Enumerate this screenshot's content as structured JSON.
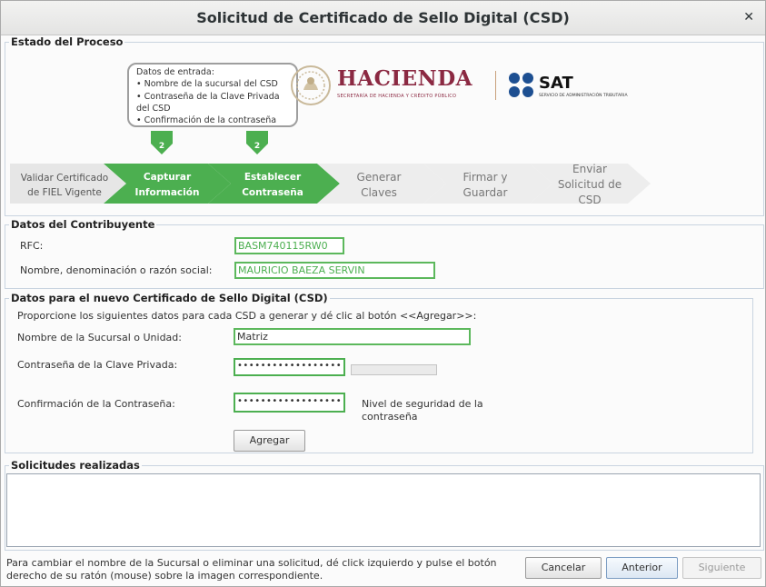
{
  "window": {
    "title": "Solicitud de Certificado de Sello Digital (CSD)",
    "close_glyph": "✕"
  },
  "proceso": {
    "legend": "Estado del Proceso",
    "bubble": {
      "header": "Datos de entrada:",
      "lines": [
        "• Nombre de la sucursal del CSD",
        "• Contraseña de la Clave Privada",
        "del CSD",
        "• Confirmación de la contraseña"
      ]
    },
    "markers": [
      "2",
      "2"
    ],
    "steps": [
      {
        "line1": "Validar Certificado",
        "line2": "de FIEL Vigente",
        "state": "done"
      },
      {
        "line1": "Capturar",
        "line2": "Información",
        "state": "active"
      },
      {
        "line1": "Establecer",
        "line2": "Contraseña",
        "state": "active"
      },
      {
        "line1": "Generar",
        "line2": "Claves",
        "state": "todo"
      },
      {
        "line1": "Firmar y",
        "line2": "Guardar",
        "state": "todo"
      },
      {
        "line1": "Enviar",
        "line2": "Solicitud de",
        "line3": "CSD",
        "state": "todo"
      }
    ],
    "logos": {
      "hacienda_title": "HACIENDA",
      "hacienda_sub": "SECRETARÍA DE HACIENDA Y CRÉDITO PÚBLICO",
      "sat_title": "SAT",
      "sat_sub": "SERVICIO DE ADMINISTRACIÓN TRIBUTARIA"
    }
  },
  "contribuyente": {
    "legend": "Datos del Contribuyente",
    "rfc_label": "RFC:",
    "rfc_value": "BASM740115RW0",
    "nombre_label": "Nombre, denominación o razón social:",
    "nombre_value": "MAURICIO BAEZA SERVIN"
  },
  "csd": {
    "legend": "Datos para el nuevo Certificado de Sello Digital (CSD)",
    "instructions": "Proporcione los siguientes datos para cada CSD a generar y dé clic al botón <<Agregar>>:",
    "sucursal_label": "Nombre de la Sucursal o Unidad:",
    "sucursal_value": "Matriz",
    "password_label": "Contraseña de la Clave Privada:",
    "password_value": "••••••••••••••••••",
    "confirm_label": "Confirmación de la Contraseña:",
    "confirm_value": "••••••••••••••••••",
    "strength_label_1": "Nivel de seguridad de la",
    "strength_label_2": "contraseña",
    "add_button": "Agregar"
  },
  "solicitudes": {
    "legend": "Solicitudes realizadas"
  },
  "footer": {
    "hint_1": "Para cambiar el nombre de la Sucursal o eliminar una solicitud, dé click izquierdo y pulse el botón",
    "hint_2": "derecho de su ratón (mouse) sobre la imagen correspondiente.",
    "cancel": "Cancelar",
    "back": "Anterior",
    "next": "Siguiente"
  },
  "colors": {
    "accent_green": "#5cb85c",
    "hacienda_red": "#8b2942",
    "sat_blue": "#1d4f91"
  }
}
